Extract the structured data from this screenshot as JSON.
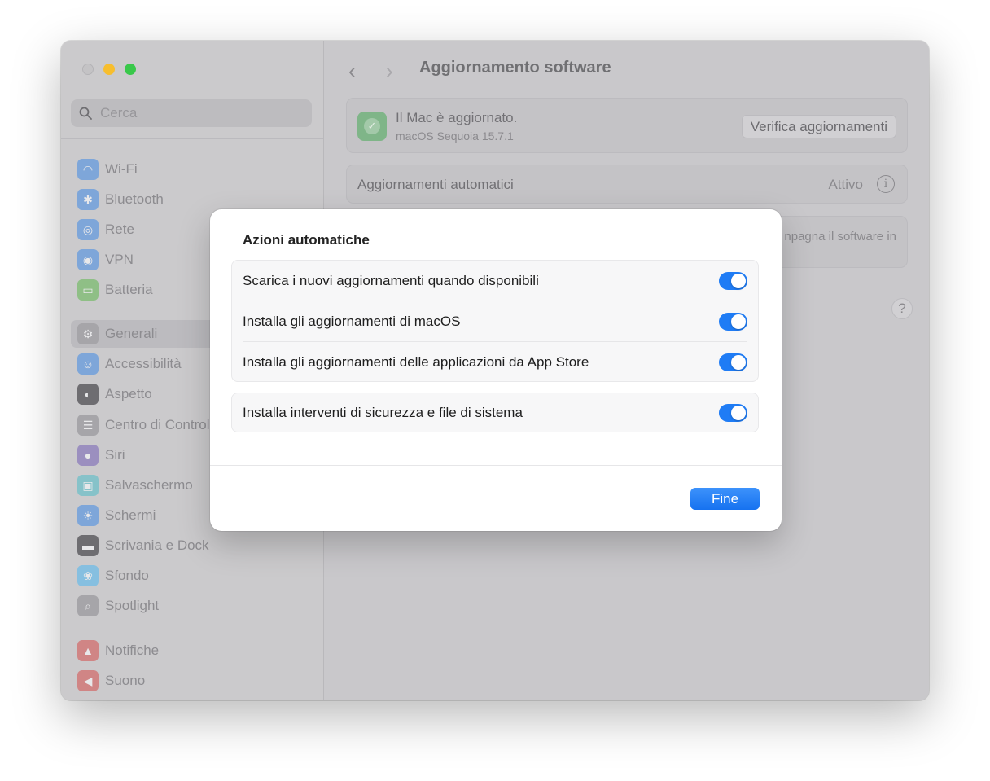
{
  "window": {
    "search": {
      "placeholder": "Cerca"
    },
    "sidebar": {
      "items": [
        {
          "label": "Wi-Fi",
          "icon": "wifi-icon",
          "color": "#7ea6d9"
        },
        {
          "label": "Bluetooth",
          "icon": "bluetooth-icon",
          "color": "#7ea6d9"
        },
        {
          "label": "Rete",
          "icon": "globe-icon",
          "color": "#7ea6d9"
        },
        {
          "label": "VPN",
          "icon": "vpn-icon",
          "color": "#7ea6d9"
        },
        {
          "label": "Batteria",
          "icon": "battery-icon",
          "color": "#8fbf86"
        },
        {
          "label": "Generali",
          "icon": "gear-icon",
          "color": "#a6a5a9",
          "selected": true
        },
        {
          "label": "Accessibilità",
          "icon": "accessibility-icon",
          "color": "#7ea6d9"
        },
        {
          "label": "Aspetto",
          "icon": "appearance-icon",
          "color": "#6e6d71"
        },
        {
          "label": "Centro di Controllo",
          "icon": "control-center-icon",
          "color": "#a6a5a9"
        },
        {
          "label": "Siri",
          "icon": "siri-icon",
          "color": "#9b8fbf"
        },
        {
          "label": "Salvaschermo",
          "icon": "screensaver-icon",
          "color": "#86c2c9"
        },
        {
          "label": "Schermi",
          "icon": "display-icon",
          "color": "#7ea6d9"
        },
        {
          "label": "Scrivania e Dock",
          "icon": "dock-icon",
          "color": "#6e6d71"
        },
        {
          "label": "Sfondo",
          "icon": "wallpaper-icon",
          "color": "#86bfe0"
        },
        {
          "label": "Spotlight",
          "icon": "spotlight-icon",
          "color": "#a6a5a9"
        },
        {
          "label": "Notifiche",
          "icon": "bell-icon",
          "color": "#d08585"
        },
        {
          "label": "Suono",
          "icon": "speaker-icon",
          "color": "#d08585"
        }
      ]
    },
    "content": {
      "title": "Aggiornamento software",
      "status_title": "Il Mac è aggiornato.",
      "status_subtitle": "macOS Sequoia 15.7.1",
      "check_button": "Verifica aggiornamenti",
      "auto_updates_label": "Aggiornamenti automatici",
      "auto_updates_state": "Attivo",
      "partial_text": "npagna il software in",
      "help": "?"
    }
  },
  "sheet": {
    "title": "Azioni automatiche",
    "options": [
      {
        "label": "Scarica i nuovi aggiornamenti quando disponibili",
        "on": true
      },
      {
        "label": "Installa gli aggiornamenti di macOS",
        "on": true
      },
      {
        "label": "Installa gli aggiornamenti delle applicazioni da App Store",
        "on": true
      }
    ],
    "security_option": {
      "label": "Installa interventi di sicurezza e file di sistema",
      "on": true
    },
    "done_button": "Fine",
    "accent_color": "#1f7cf5"
  }
}
